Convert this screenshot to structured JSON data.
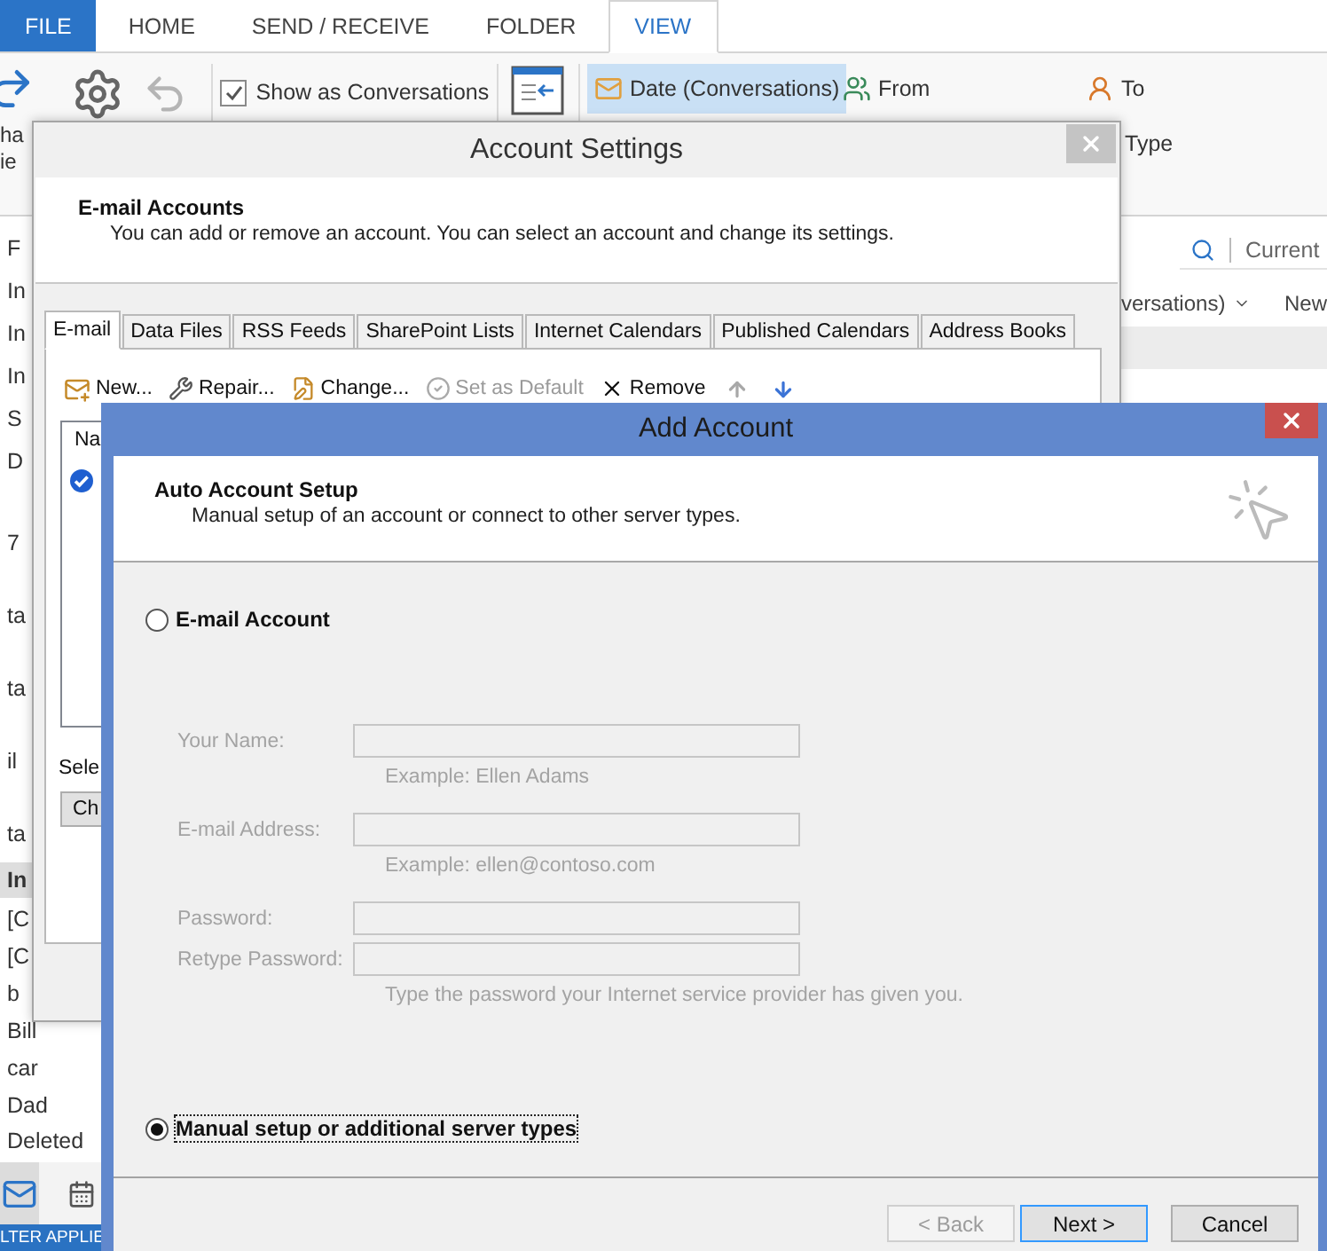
{
  "ribbon": {
    "tabs": [
      {
        "label": "FILE",
        "kind": "file",
        "selected": false
      },
      {
        "label": "HOME",
        "kind": "tab",
        "selected": false
      },
      {
        "label": "SEND / RECEIVE",
        "kind": "tab",
        "selected": false
      },
      {
        "label": "FOLDER",
        "kind": "tab",
        "selected": false
      },
      {
        "label": "VIEW",
        "kind": "tab",
        "selected": true
      }
    ],
    "cut_labels": [
      "ha",
      "ie"
    ],
    "conversations": {
      "label": "Show as Conversations",
      "checked": true
    },
    "arrangement": [
      {
        "label": "Date (Conversations)",
        "kind": "date",
        "selected": true
      },
      {
        "label": "From",
        "kind": "from",
        "selected": false
      },
      {
        "label": "To",
        "kind": "to",
        "selected": false
      },
      {
        "label": "Type",
        "kind": "type",
        "selected": false
      }
    ]
  },
  "folder_pane": {
    "items": [
      {
        "label": "F",
        "selected": false
      },
      {
        "label": "In",
        "selected": false
      },
      {
        "label": "In",
        "selected": false
      },
      {
        "label": "In",
        "selected": false
      },
      {
        "label": "S",
        "selected": false
      },
      {
        "label": "D",
        "selected": false
      },
      {
        "label": "7",
        "selected": false
      },
      {
        "label": "ta",
        "selected": false
      },
      {
        "label": "ta",
        "selected": false
      },
      {
        "label": "il",
        "selected": false
      },
      {
        "label": "ta",
        "selected": false
      },
      {
        "label": "In",
        "selected": true
      },
      {
        "label": "[C",
        "selected": false
      },
      {
        "label": "[C",
        "selected": false
      },
      {
        "label": "b",
        "selected": false
      },
      {
        "label": "Bill",
        "selected": false
      },
      {
        "label": "car",
        "selected": false
      },
      {
        "label": "Dad",
        "selected": false
      },
      {
        "label": "Deleted",
        "selected": false
      }
    ],
    "nav": [
      {
        "kind": "mail",
        "selected": true
      },
      {
        "kind": "calendar",
        "selected": false
      }
    ]
  },
  "message_list": {
    "search_placeholder": "Current",
    "sort_label": "versations)",
    "new_label": "New"
  },
  "status_bar": {
    "text": "LTER APPLIE"
  },
  "account_settings": {
    "title": "Account Settings",
    "header_title": "E-mail Accounts",
    "header_text": "You can add or remove an account. You can select an account and change its settings.",
    "tabs": [
      {
        "label": "E-mail",
        "selected": true
      },
      {
        "label": "Data Files",
        "selected": false
      },
      {
        "label": "RSS Feeds",
        "selected": false
      },
      {
        "label": "SharePoint Lists",
        "selected": false
      },
      {
        "label": "Internet Calendars",
        "selected": false
      },
      {
        "label": "Published Calendars",
        "selected": false
      },
      {
        "label": "Address Books",
        "selected": false
      }
    ],
    "toolbar": [
      {
        "label": "New...",
        "kind": "new",
        "disabled": false
      },
      {
        "label": "Repair...",
        "kind": "repair",
        "disabled": false
      },
      {
        "label": "Change...",
        "kind": "change",
        "disabled": false
      },
      {
        "label": "Set as Default",
        "kind": "default",
        "disabled": true
      },
      {
        "label": "Remove",
        "kind": "remove",
        "disabled": false
      },
      {
        "kind": "up",
        "disabled": true
      },
      {
        "kind": "down",
        "disabled": false
      }
    ],
    "list_header": "Na",
    "select_label": "Sele",
    "change_button": "Ch"
  },
  "add_account": {
    "title": "Add Account",
    "header_title": "Auto Account Setup",
    "header_text": "Manual setup of an account or connect to other server types.",
    "options": [
      {
        "label": "E-mail Account",
        "selected": false,
        "focused": false
      },
      {
        "label": "Manual setup or additional server types",
        "selected": true,
        "focused": true
      }
    ],
    "form_disabled": true,
    "fields": [
      {
        "label": "Your Name:",
        "hint": "Example: Ellen Adams"
      },
      {
        "label": "E-mail Address:",
        "hint": "Example: ellen@contoso.com"
      },
      {
        "label": "Password:"
      },
      {
        "label": "Retype Password:",
        "hint": "Type the password your Internet service provider has given you."
      }
    ],
    "buttons": [
      {
        "label": "< Back",
        "kind": "back",
        "disabled": true,
        "default": false
      },
      {
        "label": "Next >",
        "kind": "next",
        "disabled": false,
        "default": true
      },
      {
        "label": "Cancel",
        "kind": "cancel",
        "disabled": false,
        "default": false
      }
    ]
  }
}
